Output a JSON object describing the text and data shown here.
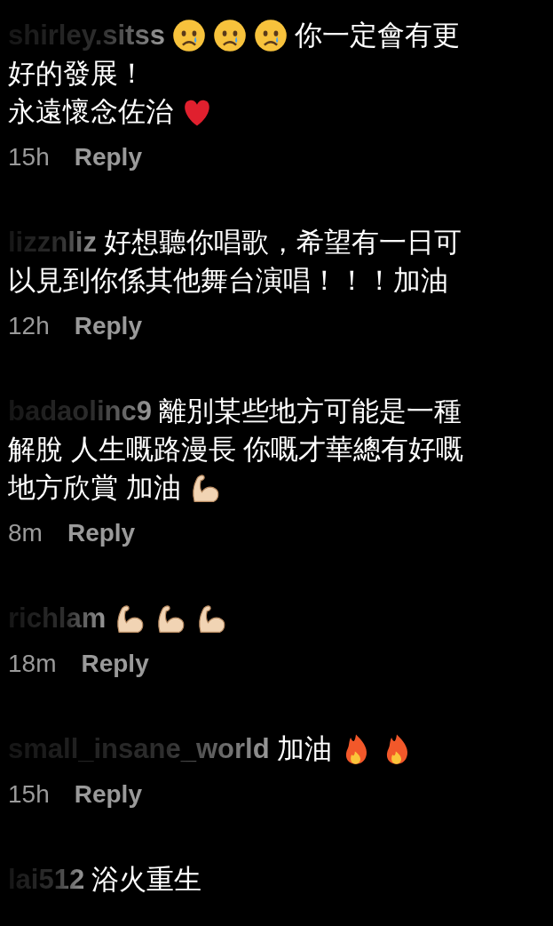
{
  "comments": [
    {
      "username": "shirley.sitss",
      "lines": [
        [
          {
            "kind": "crying"
          },
          {
            "kind": "crying"
          },
          {
            "kind": "crying"
          },
          {
            "kind": "text",
            "text": "你一定會有更"
          }
        ],
        [
          {
            "kind": "text",
            "text": "好的發展！"
          }
        ],
        [
          {
            "kind": "text",
            "text": "永遠懷念佐治"
          },
          {
            "kind": "heart"
          }
        ]
      ],
      "time": "15h",
      "reply": "Reply"
    },
    {
      "username": "lizznliz",
      "lines": [
        [
          {
            "kind": "text",
            "text": "好想聽你唱歌，希望有一日可"
          }
        ],
        [
          {
            "kind": "text",
            "text": "以見到你係其他舞台演唱！！！加油"
          }
        ]
      ],
      "time": "12h",
      "reply": "Reply"
    },
    {
      "username": "badaolinc9",
      "lines": [
        [
          {
            "kind": "text",
            "text": "離別某些地方可能是一種"
          }
        ],
        [
          {
            "kind": "text",
            "text": "解脫 人生嘅路漫長 你嘅才華總有好嘅"
          }
        ],
        [
          {
            "kind": "text",
            "text": "地方欣賞 加油"
          },
          {
            "kind": "bicep"
          }
        ]
      ],
      "time": "8m",
      "reply": "Reply"
    },
    {
      "username": "richlam",
      "lines": [
        [
          {
            "kind": "bicep"
          },
          {
            "kind": "bicep"
          },
          {
            "kind": "bicep"
          }
        ]
      ],
      "time": "18m",
      "reply": "Reply"
    },
    {
      "username": "small_insane_world",
      "lines": [
        [
          {
            "kind": "text",
            "text": "加油"
          },
          {
            "kind": "fire"
          },
          {
            "kind": "fire"
          }
        ]
      ],
      "time": "15h",
      "reply": "Reply"
    },
    {
      "username": "lai512",
      "lines": [
        [
          {
            "kind": "text",
            "text": "浴火重生"
          }
        ]
      ]
    }
  ]
}
